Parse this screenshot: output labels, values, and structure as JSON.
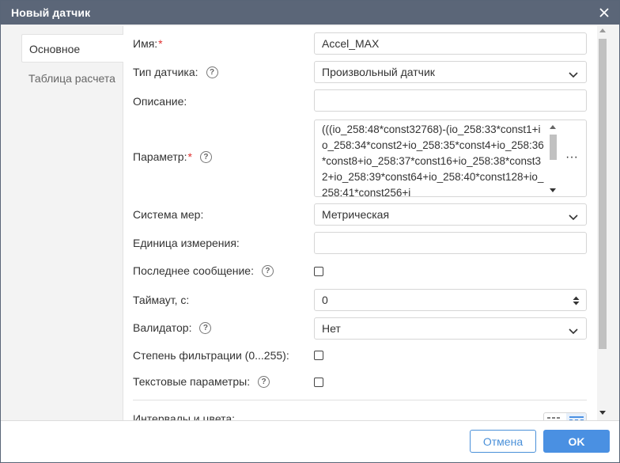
{
  "dialog": {
    "title": "Новый датчик",
    "close_label": "×"
  },
  "tabs": [
    {
      "label": "Основное",
      "active": true
    },
    {
      "label": "Таблица расчета",
      "active": false
    }
  ],
  "form": {
    "name": {
      "label": "Имя:",
      "required_mark": "*",
      "value": "Accel_MAX"
    },
    "sensor_type": {
      "label": "Тип датчика:",
      "help": "?",
      "value": "Произвольный датчик"
    },
    "description": {
      "label": "Описание:",
      "value": ""
    },
    "parameter": {
      "label": "Параметр:",
      "required_mark": "*",
      "help": "?",
      "value": "(((io_258:48*const32768)-(io_258:33*const1+io_258:34*const2+io_258:35*const4+io_258:36*const8+io_258:37*const16+io_258:38*const32+io_258:39*const64+io_258:40*const128+io_258:41*const256+i",
      "more_label": "···"
    },
    "unit_system": {
      "label": "Система мер:",
      "value": "Метрическая"
    },
    "unit": {
      "label": "Единица измерения:",
      "value": ""
    },
    "last_message": {
      "label": "Последнее сообщение:",
      "help": "?",
      "checked": false
    },
    "timeout": {
      "label": "Таймаут, с:",
      "value": "0"
    },
    "validator": {
      "label": "Валидатор:",
      "help": "?",
      "value": "Нет"
    },
    "filtration": {
      "label": "Степень фильтрации (0...255):",
      "checked": false
    },
    "text_params": {
      "label": "Текстовые параметры:",
      "help": "?",
      "checked": false
    },
    "intervals": {
      "label": "Интервалы и цвета:"
    }
  },
  "footer": {
    "cancel_label": "Отмена",
    "ok_label": "OK"
  },
  "colors": {
    "titlebar": "#5b6678",
    "accent": "#4a90e2",
    "required": "#e0302f"
  }
}
